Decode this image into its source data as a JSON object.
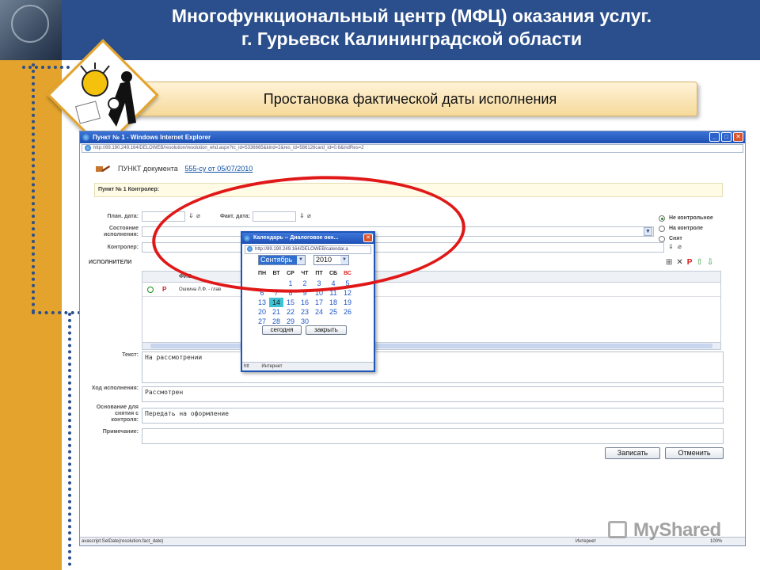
{
  "slide": {
    "title_line1": "Многофункциональный центр (МФЦ) оказания услуг.",
    "title_line2": "г. Гурьевск Калининградской области",
    "ribbon_text": "Простановка фактической даты исполнения"
  },
  "browser": {
    "title": "Пункт № 1 - Windows Internet Explorer",
    "url": "http://89.190.249.164/DELOWEB/resolution/resolution_ehd.aspx?rc_id=5336665&kind=2&res_id=586126card_id=0.6&indRes=2",
    "status_left": "avascript:SelDate(resolution.fact_date)",
    "status_zone": "Интернет",
    "status_zoom": "100%"
  },
  "doc": {
    "label": "ПУНКТ документа",
    "link": "555-су от 05/07/2010",
    "punkt_info": "Пункт № 1   Контролер:"
  },
  "form": {
    "plan_date_label": "План. дата:",
    "fact_date_label": "Факт. дата:",
    "state_label": "Состояние исполнения:",
    "controller_label": "Контролер:",
    "executors_label": "ИСПОЛНИТЕЛИ",
    "grid_header": "ФИО",
    "grid_row1": "Ошкина Л.Ф. - глав",
    "text_label": "Текст:",
    "text_value": "На рассмотрении",
    "progress_label": "Ход исполнения:",
    "progress_value": "Рассмотрен",
    "basis_label": "Основание для снятия с контроля:",
    "basis_value": "Передать на оформление",
    "note_label": "Примечание:",
    "note_value": "",
    "save_button": "Записать",
    "cancel_button": "Отменить",
    "radio_options": [
      "Не контрольное",
      "На контроле",
      "Снят"
    ]
  },
  "calendar": {
    "title": "Календарь -- Диалоговое окн...",
    "url": "http://89.190.249.164/DELOWEB/calendar.a",
    "month": "Сентябрь",
    "year": "2010",
    "weekdays": [
      "ПН",
      "ВТ",
      "СР",
      "ЧТ",
      "ПТ",
      "СБ",
      "ВС"
    ],
    "weeks": [
      [
        "",
        "",
        "1",
        "2",
        "3",
        "4",
        "5"
      ],
      [
        "6",
        "7",
        "8",
        "9",
        "10",
        "11",
        "12"
      ],
      [
        "13",
        "14",
        "15",
        "16",
        "17",
        "18",
        "19"
      ],
      [
        "20",
        "21",
        "22",
        "23",
        "24",
        "25",
        "26"
      ],
      [
        "27",
        "28",
        "29",
        "30",
        "",
        "",
        ""
      ]
    ],
    "selected_day": "14",
    "today_button": "сегодня",
    "close_button": "закрыть",
    "status_left": "htt",
    "status_zone": "Интернет"
  },
  "watermark": "MyShared"
}
